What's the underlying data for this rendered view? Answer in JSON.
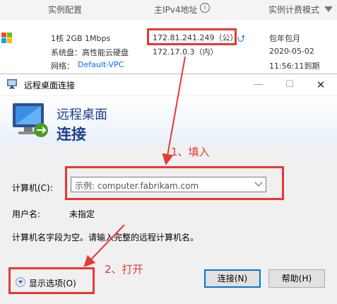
{
  "table": {
    "header": {
      "config": "实例配置",
      "ip": "主IPv4地址",
      "billing": "实例计费模式"
    },
    "row": {
      "config": "1核 2GB 1Mbps",
      "disk": "系统盘：高性能云硬盘",
      "network_label": "网络：",
      "network": "Default-VPC",
      "public_ip": "172.81.241.249（公）",
      "private_ip": "172.17.0.3（内）",
      "billing": "包年包月",
      "date": "2020-05-02",
      "expire": "11:56:11到期"
    }
  },
  "annotations": {
    "step1": "1、填入",
    "step2": "2、打开"
  },
  "dialog": {
    "title": "远程桌面连接",
    "banner_line1": "远程桌面",
    "banner_line2": "连接",
    "computer_label": "计算机(C):",
    "computer_placeholder": "示例: computer.fabrikam.com",
    "user_label": "用户名:",
    "user_value": "未指定",
    "message": "计算机名字段为空。请输入完整的远程计算机名。",
    "show_options": "显示选项(O)",
    "connect": "连接(N)",
    "help": "帮助(H)"
  },
  "colors": {
    "accent": "#006eff",
    "annotation": "#e53935",
    "banner_text": "#1c3f8c"
  }
}
